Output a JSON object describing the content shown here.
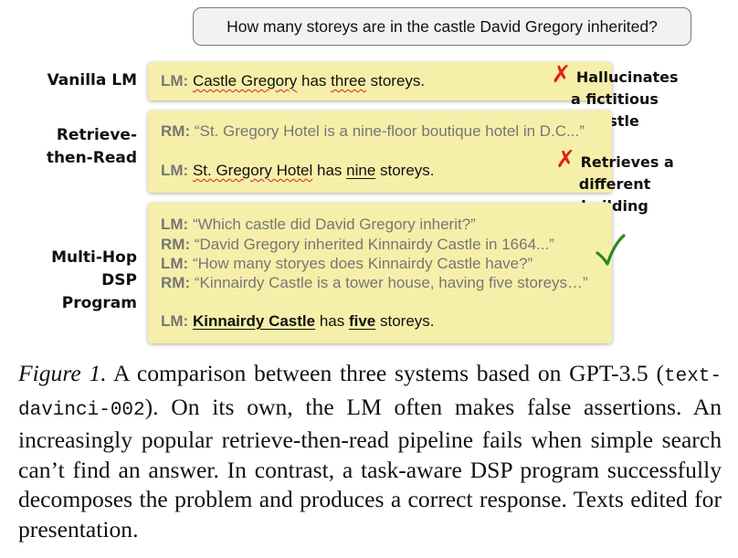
{
  "question": "How many storeys are in the castle David Gregory inherited?",
  "systems": {
    "vanilla": {
      "label": "Vanilla LM",
      "lm_tag": "LM:",
      "answer_entity": "Castle Gregory",
      "answer_mid": " has ",
      "answer_number": "three",
      "answer_end": " storeys.",
      "note_mark": "✗",
      "note_line1": "Hallucinates",
      "note_line2": "a fictitious castle"
    },
    "retrieve": {
      "label_line1": "Retrieve-",
      "label_line2": "then-Read",
      "rm_tag": "RM:",
      "rm_text": " “St. Gregory Hotel is a nine-floor boutique hotel in D.C...”",
      "lm_tag": "LM:",
      "answer_entity": "St. Gregory Hotel",
      "answer_mid": " has ",
      "answer_number": "nine",
      "answer_end": " storeys.",
      "note_mark": "✗",
      "note_line1": "Retrieves a",
      "note_line2": "different building"
    },
    "multihop": {
      "label_line1": "Multi-Hop",
      "label_line2": "DSP Program",
      "steps": [
        {
          "tag": "LM:",
          "text": " “Which castle did David Gregory inherit?”"
        },
        {
          "tag": "RM:",
          "text": " “David Gregory inherited Kinnairdy Castle in 1664...”"
        },
        {
          "tag": "LM:",
          "text": " “How many storyes does Kinnairdy Castle have?”"
        },
        {
          "tag": "RM:",
          "text": " “Kinnairdy Castle is a tower house, having five storeys…”"
        }
      ],
      "lm_tag": "LM:",
      "answer_entity": "Kinnairdy Castle",
      "answer_mid": " has ",
      "answer_number": "five",
      "answer_end": " storeys."
    }
  },
  "caption": {
    "figure_label": "Figure 1.",
    "text_a": " A comparison between three systems based on GPT-3.5 (",
    "model_code": "text-davinci-002",
    "text_b": "). On its own, the LM often makes false assertions. An increasingly popular retrieve-then-read pipeline fails when simple search can’t find an answer. In contrast, a task-aware DSP program successfully decomposes the problem and produces a correct response. Texts edited for presentation."
  },
  "colors": {
    "panel": "#f6efa9",
    "cross": "#e0201c",
    "check": "#2b8a1e",
    "muted_text": "#767676"
  },
  "icons": {
    "cross": "x-mark-icon",
    "check": "check-mark-icon"
  }
}
